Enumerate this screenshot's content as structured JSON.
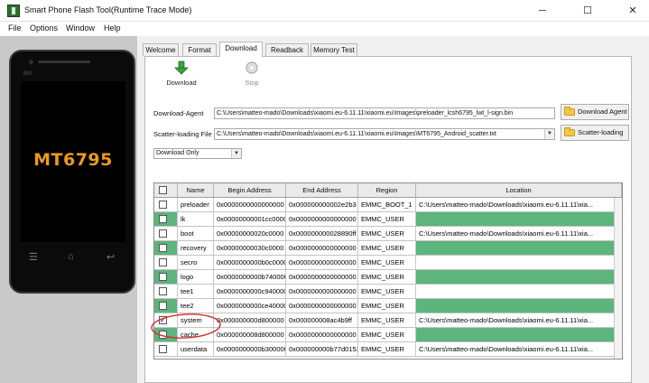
{
  "window": {
    "title": "Smart Phone Flash Tool(Runtime Trace Mode)",
    "minimize": "─",
    "maximize": "☐",
    "close": "✕"
  },
  "menu": [
    "File",
    "Options",
    "Window",
    "Help"
  ],
  "phone": {
    "chip": "MT6795",
    "brand": "BM",
    "key_back": "↩",
    "key_home": "⌂",
    "key_menu": "☰"
  },
  "tabs": [
    {
      "label": "Welcome",
      "active": false
    },
    {
      "label": "Format",
      "active": false
    },
    {
      "label": "Download",
      "active": true
    },
    {
      "label": "Readback",
      "active": false
    },
    {
      "label": "Memory Test",
      "active": false
    }
  ],
  "toolbar": {
    "download_label": "Download",
    "stop_label": "Stop",
    "download_icon": "green-down-arrow",
    "stop_icon": "stop-circle"
  },
  "download_agent": {
    "label": "Download-Agent",
    "value": "C:\\Users\\matteo-mado\\Downloads\\xiaomi.eu-6.11.11\\xiaomi.eu\\Images\\preloader_lcsh6795_lwt_l-sign.bin",
    "button": "Download Agent"
  },
  "scatter": {
    "label": "Scatter-loading File",
    "value": "C:\\Users\\matteo-mado\\Downloads\\xiaomi.eu-6.11.11\\xiaomi.eu\\Images\\MT6795_Android_scatter.txt",
    "button": "Scatter-loading"
  },
  "mode": {
    "selected": "Download Only"
  },
  "table": {
    "headers": [
      "Name",
      "Begin Address",
      "End Address",
      "Region",
      "Location"
    ],
    "rows": [
      {
        "checked": false,
        "green": false,
        "name": "preloader",
        "begin": "0x0000000000000000",
        "end": "0x000000000002e2b3",
        "region": "EMMC_BOOT_1",
        "location": "C:\\Users\\matteo-mado\\Downloads\\xiaomi.eu-6.11.11\\xia..."
      },
      {
        "checked": false,
        "green": true,
        "name": "lk",
        "begin": "0x00000000001cc0000",
        "end": "0x0000000000000000",
        "region": "EMMC_USER",
        "location": ""
      },
      {
        "checked": false,
        "green": false,
        "name": "boot",
        "begin": "0x00000000020c0000",
        "end": "0x000000000028890ff",
        "region": "EMMC_USER",
        "location": "C:\\Users\\matteo-mado\\Downloads\\xiaomi.eu-6.11.11\\xia..."
      },
      {
        "checked": false,
        "green": true,
        "name": "recovery",
        "begin": "0x00000000030c0000",
        "end": "0x0000000000000000",
        "region": "EMMC_USER",
        "location": ""
      },
      {
        "checked": false,
        "green": false,
        "name": "secro",
        "begin": "0x0000000000b0c0000",
        "end": "0x0000000000000000",
        "region": "EMMC_USER",
        "location": ""
      },
      {
        "checked": false,
        "green": true,
        "name": "logo",
        "begin": "0x0000000000b740000",
        "end": "0x0000000000000000",
        "region": "EMMC_USER",
        "location": ""
      },
      {
        "checked": false,
        "green": false,
        "name": "tee1",
        "begin": "0x0000000000c940000",
        "end": "0x0000000000000000",
        "region": "EMMC_USER",
        "location": ""
      },
      {
        "checked": false,
        "green": true,
        "name": "tee2",
        "begin": "0x0000000000ce40000",
        "end": "0x0000000000000000",
        "region": "EMMC_USER",
        "location": ""
      },
      {
        "checked": true,
        "green": false,
        "name": "system",
        "begin": "0x000000000d800000",
        "end": "0x000000008ac4b9ff",
        "region": "EMMC_USER",
        "location": "C:\\Users\\matteo-mado\\Downloads\\xiaomi.eu-6.11.11\\xia..."
      },
      {
        "checked": false,
        "green": true,
        "name": "cache",
        "begin": "0x000000008d800000",
        "end": "0x0000000000000000",
        "region": "EMMC_USER",
        "location": ""
      },
      {
        "checked": false,
        "green": false,
        "name": "userdata",
        "begin": "0x0000000000b3000000",
        "end": "0x000000000b77d0153",
        "region": "EMMC_USER",
        "location": "C:\\Users\\matteo-mado\\Downloads\\xiaomi.eu-6.11.11\\xia..."
      }
    ]
  },
  "colors": {
    "row_green": "#5bb57c",
    "chip_text": "#ee9a1a",
    "annotation_circle": "#d42a2a"
  }
}
